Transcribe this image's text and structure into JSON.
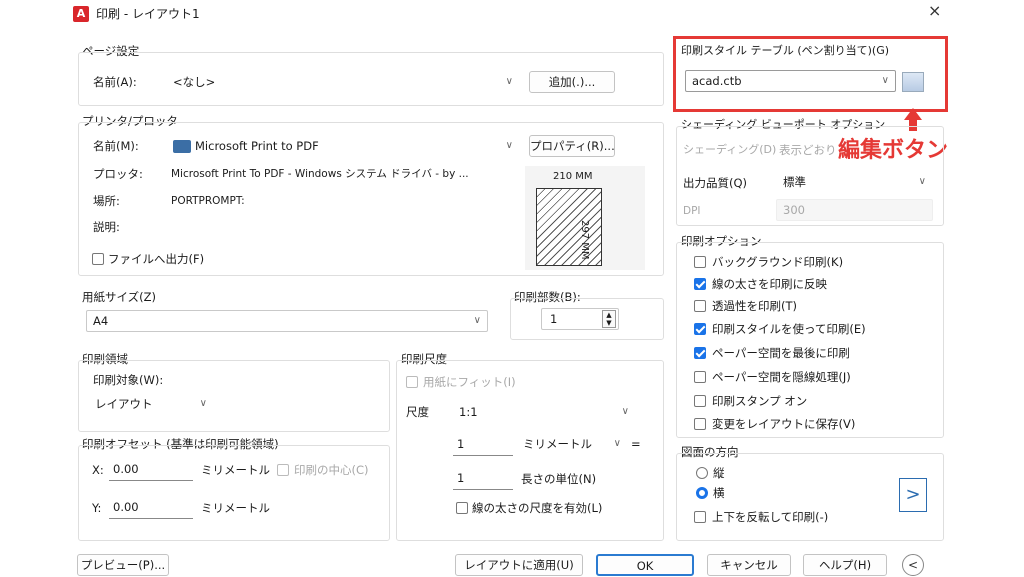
{
  "window": {
    "title": "印刷 - レイアウト1",
    "close": "×",
    "app_icon_letter": "A"
  },
  "page_setup": {
    "section": "ページ設定",
    "name_label": "名前(A):",
    "name_value": "<なし>",
    "add_button": "追加(.)..."
  },
  "printer": {
    "section": "プリンタ/プロッタ",
    "name_label": "名前(M):",
    "name_value": "Microsoft Print to PDF",
    "properties_button": "プロパティ(R)...",
    "plotter_label": "プロッタ:",
    "plotter_value": "Microsoft Print To PDF - Windows システム ドライバ - by ...",
    "location_label": "場所:",
    "location_value": "PORTPROMPT:",
    "description_label": "説明:",
    "print_to_file_label": "ファイルへ出力(F)",
    "preview_width": "210 MM",
    "preview_height": "297 MM"
  },
  "paper_size": {
    "section": "用紙サイズ(Z)",
    "value": "A4"
  },
  "copies": {
    "label": "印刷部数(B):",
    "value": "1"
  },
  "plot_area": {
    "section": "印刷領域",
    "what_label": "印刷対象(W):",
    "what_value": "レイアウト"
  },
  "plot_offset": {
    "section": "印刷オフセット (基準は印刷可能領域)",
    "x_label": "X:",
    "x_value": "0.00",
    "y_label": "Y:",
    "y_value": "0.00",
    "x_unit": "ミリメートル",
    "y_unit": "ミリメートル",
    "center_label": "印刷の中心(C)"
  },
  "plot_scale": {
    "section": "印刷尺度",
    "fit_label": "用紙にフィット(I)",
    "scale_label": "尺度",
    "scale_value": "1:1",
    "value1": "1",
    "unit1": "ミリメートル",
    "equals": "=",
    "value2": "1",
    "unit2": "長さの単位(N)",
    "lineweight_label": "線の太さの尺度を有効(L)"
  },
  "plot_style_table": {
    "section": "印刷スタイル テーブル (ペン割り当て)(G)",
    "value": "acad.ctb",
    "callout": "編集ボタン",
    "highlight_color": "#e53935"
  },
  "shaded_viewport": {
    "section": "シェーディング ビューポート オプション",
    "shade_label": "シェーディング(D)",
    "shade_value": "表示どおり",
    "quality_label": "出力品質(Q)",
    "quality_value": "標準",
    "dpi_label": "DPI",
    "dpi_value": "300"
  },
  "plot_options": {
    "section": "印刷オプション",
    "items": [
      {
        "label": "バックグラウンド印刷(K)",
        "checked": false
      },
      {
        "label": "線の太さを印刷に反映",
        "checked": true
      },
      {
        "label": "透過性を印刷(T)",
        "checked": false
      },
      {
        "label": "印刷スタイルを使って印刷(E)",
        "checked": true
      },
      {
        "label": "ペーパー空間を最後に印刷",
        "checked": true
      },
      {
        "label": "ペーパー空間を隠線処理(J)",
        "checked": false
      },
      {
        "label": "印刷スタンプ オン",
        "checked": false
      },
      {
        "label": "変更をレイアウトに保存(V)",
        "checked": false
      }
    ]
  },
  "orientation": {
    "section": "図面の方向",
    "portrait": "縦",
    "landscape": "横",
    "selected": "横",
    "upside_down": "上下を反転して印刷(-)"
  },
  "footer": {
    "preview": "プレビュー(P)...",
    "apply": "レイアウトに適用(U)",
    "ok": "OK",
    "cancel": "キャンセル",
    "help": "ヘルプ(H)"
  }
}
